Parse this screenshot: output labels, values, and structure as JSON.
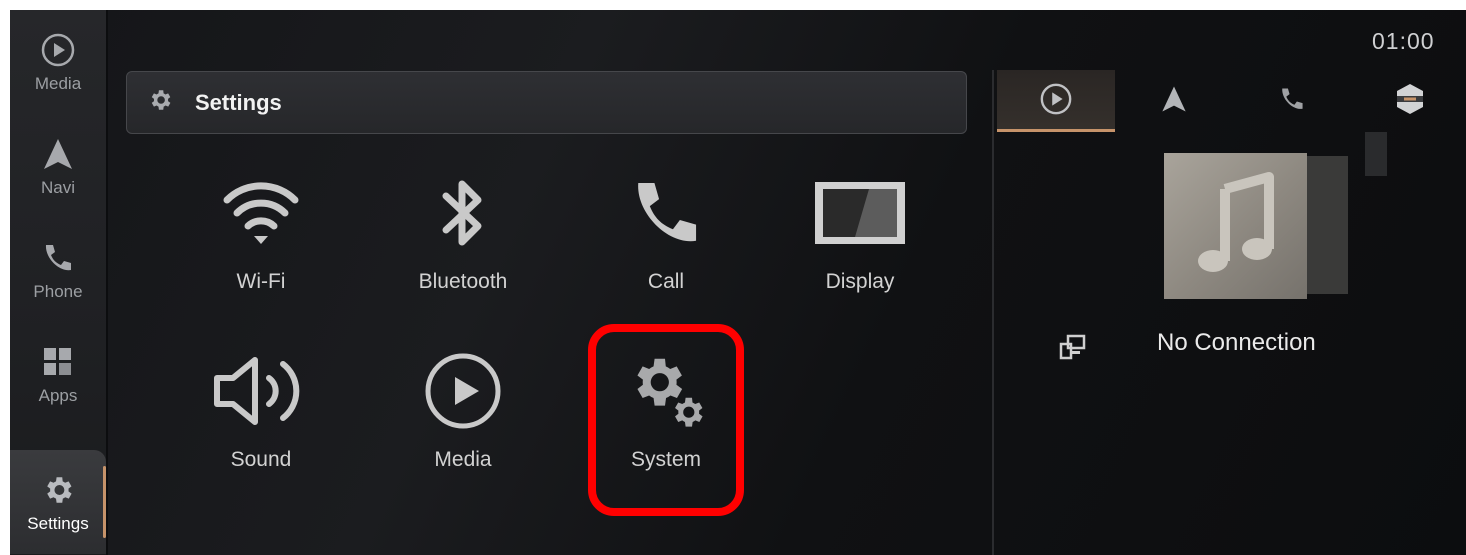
{
  "rail": {
    "items": [
      {
        "label": "Media",
        "icon": "play-circle-icon"
      },
      {
        "label": "Navi",
        "icon": "navigation-arrow-icon"
      },
      {
        "label": "Phone",
        "icon": "phone-icon"
      },
      {
        "label": "Apps",
        "icon": "apps-grid-icon"
      },
      {
        "label": "Settings",
        "icon": "gear-icon",
        "active": true
      }
    ]
  },
  "header": {
    "title": "Settings",
    "icon": "gear-icon"
  },
  "grid": {
    "items": [
      {
        "label": "Wi-Fi",
        "icon": "wifi-icon"
      },
      {
        "label": "Bluetooth",
        "icon": "bluetooth-icon"
      },
      {
        "label": "Call",
        "icon": "phone-icon"
      },
      {
        "label": "Display",
        "icon": "display-icon"
      },
      {
        "label": "Sound",
        "icon": "speaker-icon"
      },
      {
        "label": "Media",
        "icon": "play-circle-icon"
      },
      {
        "label": "System",
        "icon": "gears-icon",
        "highlighted": true
      }
    ]
  },
  "status": {
    "time": "01:00"
  },
  "right_panel": {
    "tabs": [
      {
        "icon": "play-circle-icon",
        "active": true
      },
      {
        "icon": "navigation-arrow-icon"
      },
      {
        "icon": "phone-icon"
      },
      {
        "icon": "hexagon-icon"
      }
    ],
    "connection_label": "No Connection",
    "connection_icon": "devices-icon"
  },
  "colors": {
    "accent": "#c6936a",
    "highlight": "#ff0000",
    "background": "#141518"
  }
}
